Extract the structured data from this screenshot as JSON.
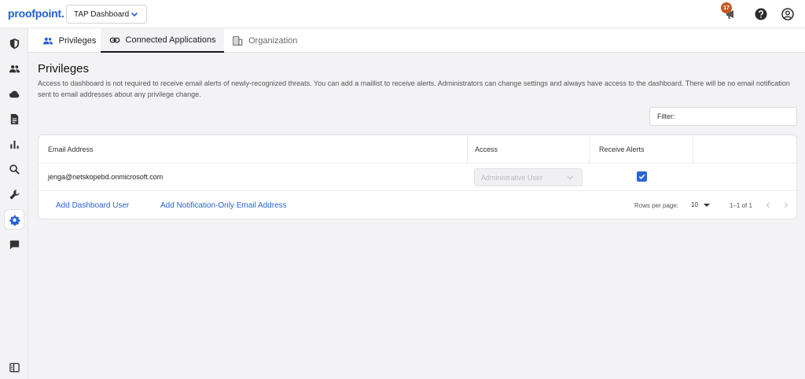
{
  "header": {
    "logo": "proofpoint.",
    "dashboard_select": "TAP Dashboard",
    "notification_count": "17",
    "icons": [
      "megaphone-icon",
      "help-icon",
      "user-icon"
    ]
  },
  "sidebar": {
    "items": [
      {
        "icon": "shield-icon",
        "active": false
      },
      {
        "icon": "people-icon",
        "active": false
      },
      {
        "icon": "cloud-icon",
        "active": false
      },
      {
        "icon": "document-icon",
        "active": false
      },
      {
        "icon": "bar-chart-icon",
        "active": false
      },
      {
        "icon": "search-icon",
        "active": false
      },
      {
        "icon": "wrench-icon",
        "active": false
      },
      {
        "icon": "gear-icon",
        "active": true
      },
      {
        "icon": "chat-icon",
        "active": false
      },
      {
        "icon": "sidebar-toggle-icon",
        "active": false
      }
    ]
  },
  "tabs": [
    {
      "label": "Privileges",
      "icon": "people-icon"
    },
    {
      "label": "Connected Applications",
      "icon": "link-icon"
    },
    {
      "label": "Organization",
      "icon": "building-icon"
    }
  ],
  "page": {
    "title": "Privileges",
    "description": "Access to dashboard is not required to receive email alerts of newly-recognized threats. You can add a maillist to receive alerts. Administrators can change settings and always have access to the dashboard. There will be no email notification sent to email addresses about any privilege change.",
    "filter_placeholder": "Filter:"
  },
  "table": {
    "columns": [
      "Email Address",
      "Access",
      "Receive Alerts",
      ""
    ],
    "rows": [
      {
        "email": "jenga@netskopebd.onmicrosoft.com",
        "access": "Administrative User",
        "receive_alerts": true
      }
    ],
    "footer": {
      "add_dashboard_user": "Add Dashboard User",
      "add_notification_email": "Add Notification-Only Email Address",
      "rows_per_page_label": "Rows per page:",
      "rows_per_page_value": "10",
      "range": "1–1 of 1"
    }
  },
  "colors": {
    "accent": "#2a64d8",
    "logo": "#1f5fd6",
    "badge": "#c45a1c"
  }
}
